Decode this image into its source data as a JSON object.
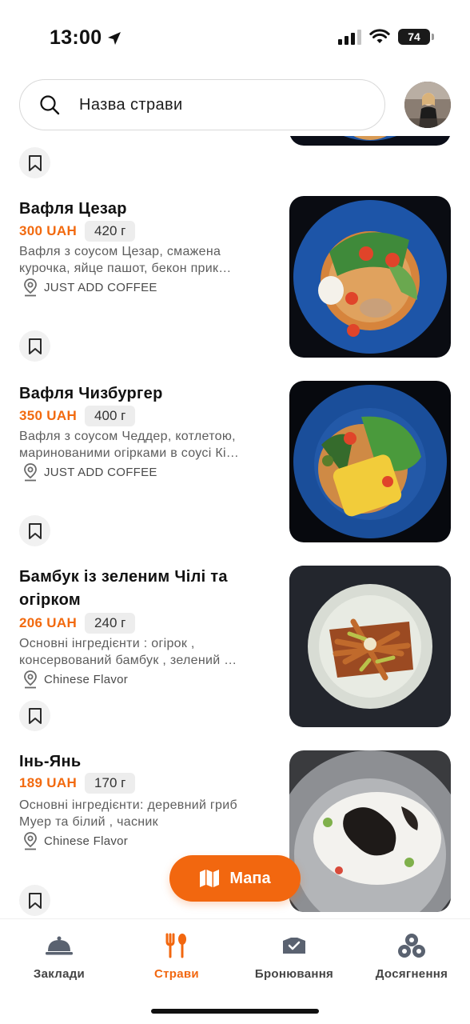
{
  "status_bar": {
    "time": "13:00",
    "battery": "74"
  },
  "search": {
    "placeholder": "Назва страви"
  },
  "dishes": [
    {
      "title_lines": [
        "Вафля Цезар"
      ],
      "price": "300 UAH",
      "weight": "420 г",
      "description_lines": [
        "Вафля з соусом Цезар, смажена",
        "курочка, яйце пашот, бекон прик…"
      ],
      "place": "JUST ADD COFFEE"
    },
    {
      "title_lines": [
        "Вафля Чизбургер"
      ],
      "price": "350 UAH",
      "weight": "400 г",
      "description_lines": [
        "Вафля з соусом Чеддер, котлетою,",
        "маринованими огірками в соусі Кі…"
      ],
      "place": "JUST ADD COFFEE"
    },
    {
      "title_lines": [
        "Бамбук із зеленим Чілі та",
        "огірком"
      ],
      "price": "206 UAH",
      "weight": "240 г",
      "description_lines": [
        "Основні інгредієнти : огірок ,",
        "консервований бамбук , зелений …"
      ],
      "place": "Chinese Flavor"
    },
    {
      "title_lines": [
        "Інь-Янь"
      ],
      "price": "189 UAH",
      "weight": "170 г",
      "description_lines": [
        "Основні інгредієнти: деревний гриб",
        "Муер та білий , часник"
      ],
      "place": "Chinese Flavor"
    }
  ],
  "map_button": {
    "label": "Мапа"
  },
  "tabs": [
    {
      "label": "Заклади",
      "icon": "cloche-icon",
      "active": false
    },
    {
      "label": "Страви",
      "icon": "fork-spoon-icon",
      "active": true
    },
    {
      "label": "Бронювання",
      "icon": "reservation-icon",
      "active": false
    },
    {
      "label": "Досягнення",
      "icon": "achievements-icon",
      "active": false
    }
  ],
  "colors": {
    "accent": "#f2670f",
    "price": "#f26a0f"
  }
}
